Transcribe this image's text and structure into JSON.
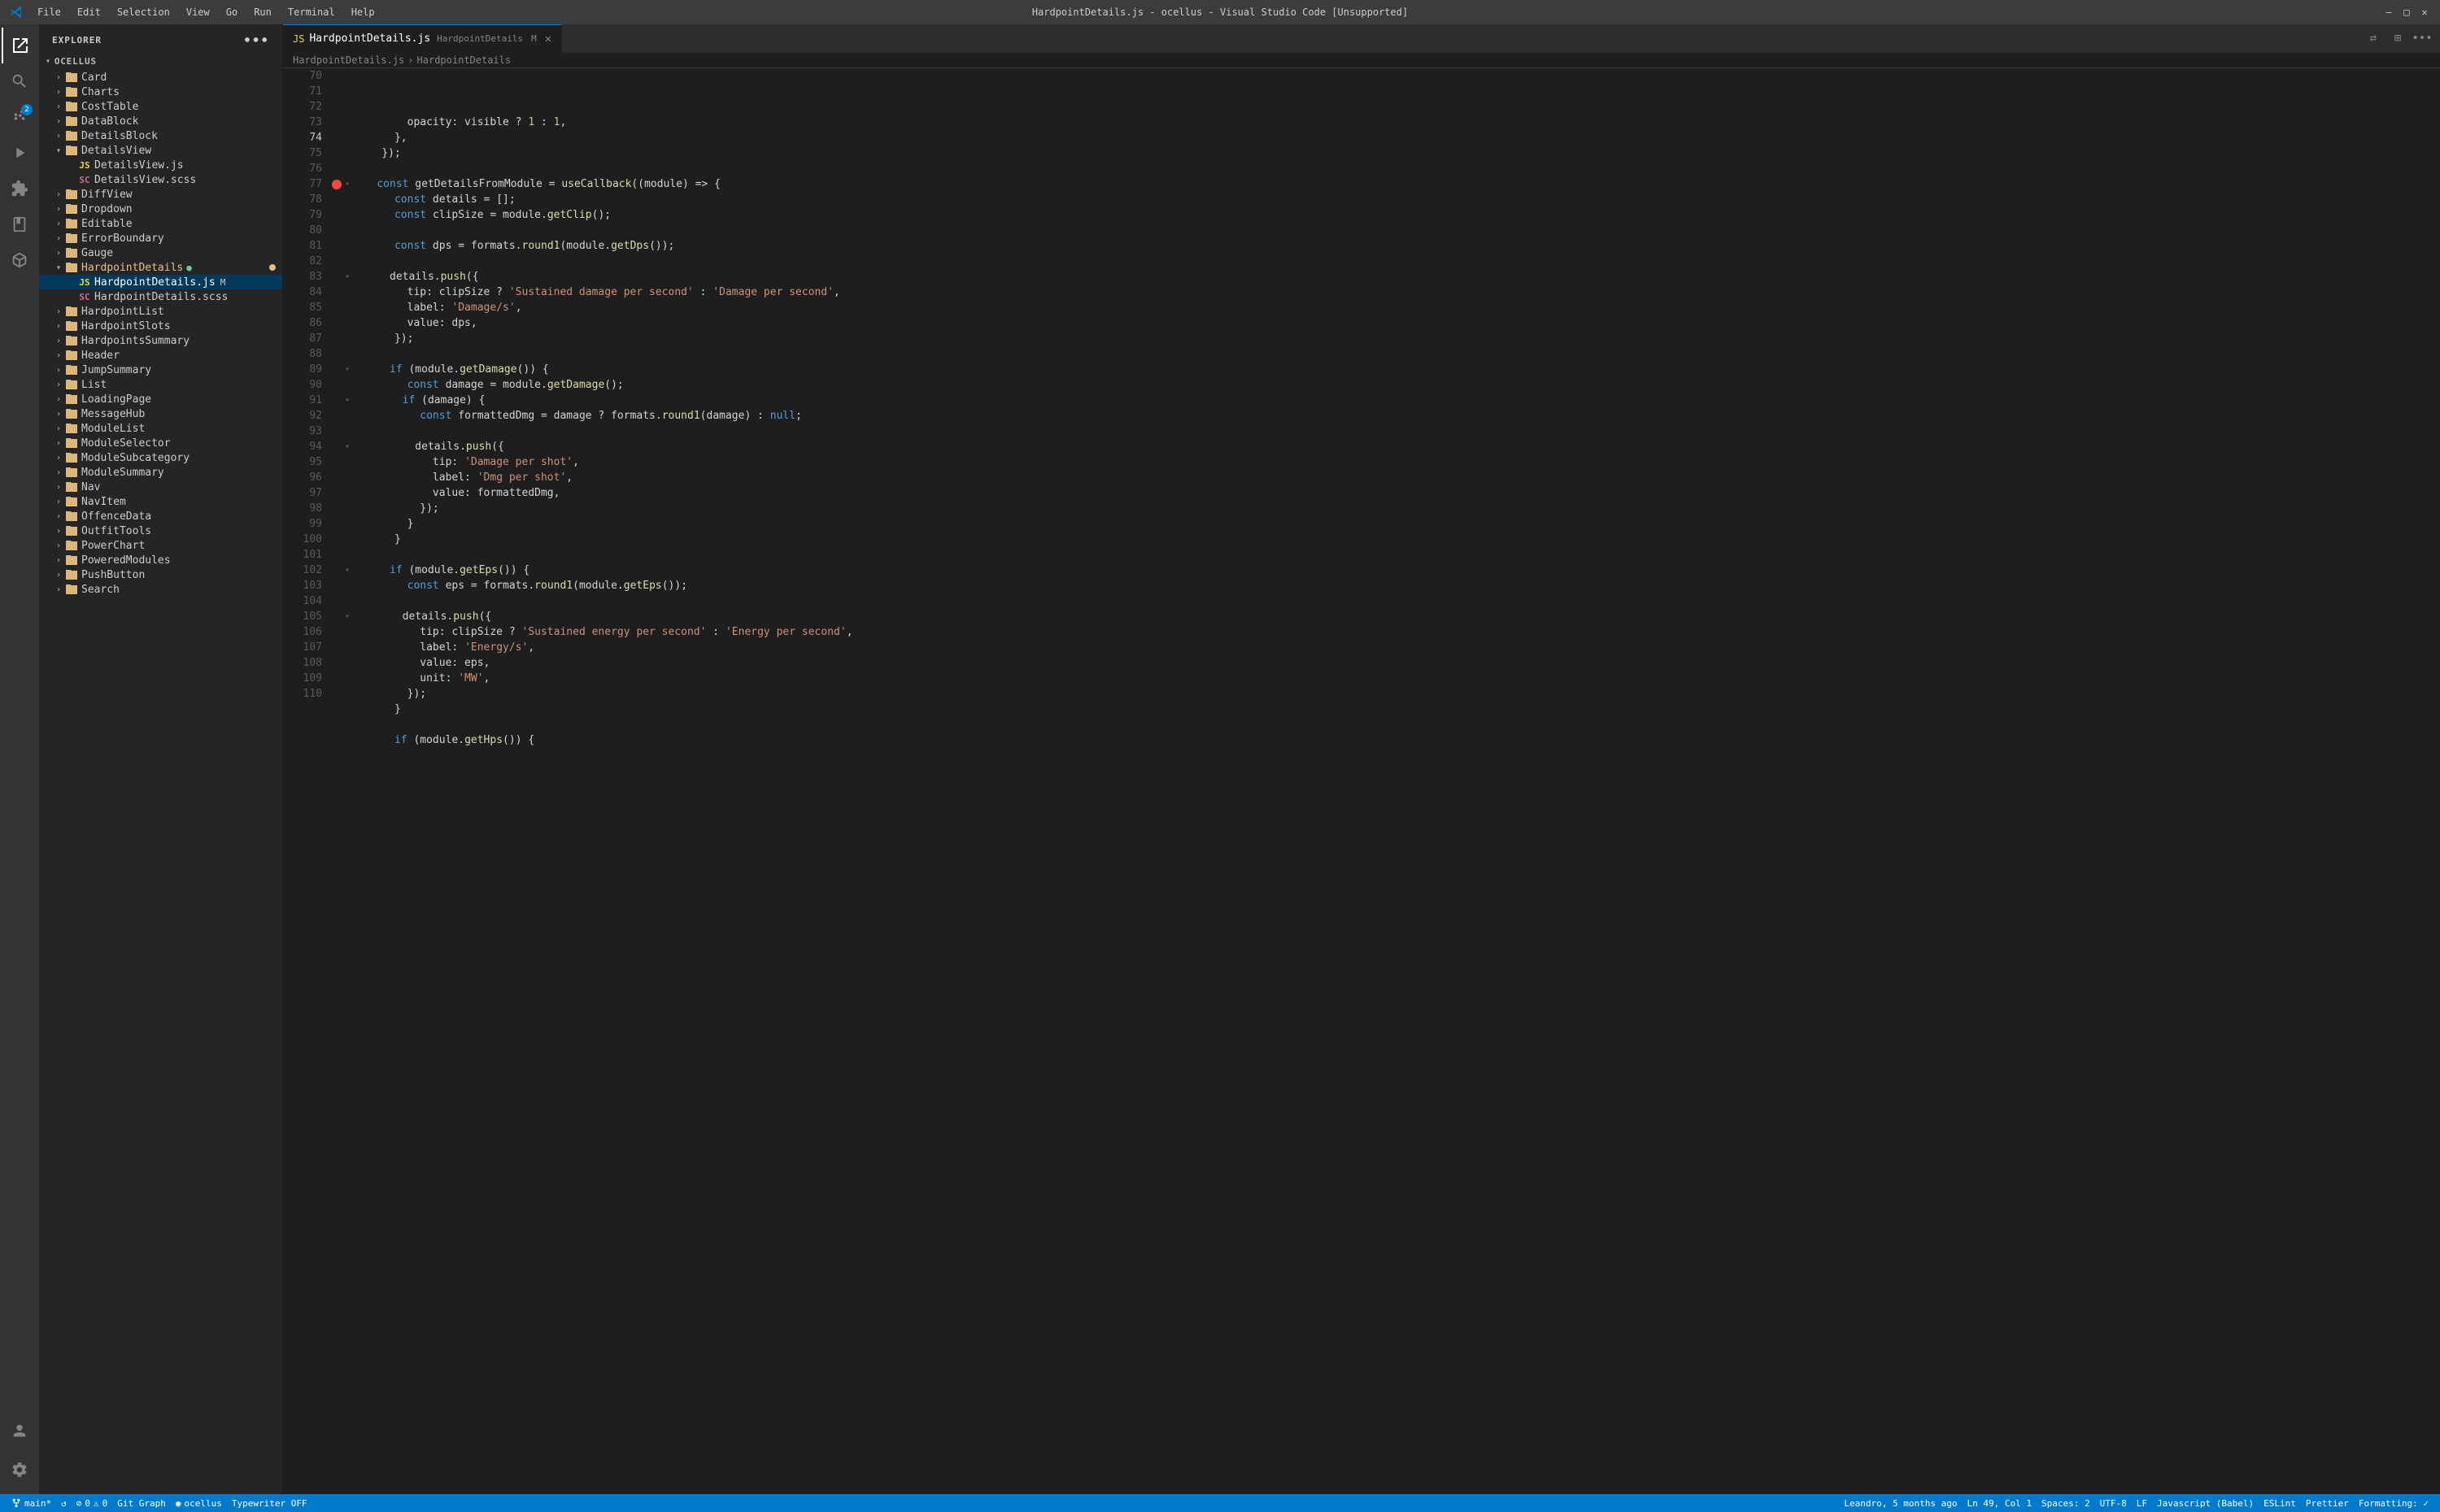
{
  "titleBar": {
    "logo": "VS",
    "menuItems": [
      "File",
      "Edit",
      "Selection",
      "View",
      "Go",
      "Run",
      "Terminal",
      "Help"
    ],
    "title": "HardpointDetails.js - ocellus - Visual Studio Code [Unsupported]",
    "controls": [
      "—",
      "□",
      "✕"
    ]
  },
  "activityBar": {
    "icons": [
      {
        "name": "explorer-icon",
        "symbol": "⎘",
        "active": true,
        "badge": null
      },
      {
        "name": "search-icon",
        "symbol": "🔍",
        "active": false,
        "badge": null
      },
      {
        "name": "source-control-icon",
        "symbol": "⎇",
        "active": false,
        "badge": "2"
      },
      {
        "name": "run-icon",
        "symbol": "▷",
        "active": false,
        "badge": null
      },
      {
        "name": "extensions-icon",
        "symbol": "⊞",
        "active": false,
        "badge": null
      },
      {
        "name": "book-icon",
        "symbol": "📖",
        "active": false,
        "badge": null
      },
      {
        "name": "box-icon",
        "symbol": "📦",
        "active": false,
        "badge": null
      }
    ],
    "bottomIcons": [
      {
        "name": "account-icon",
        "symbol": "👤"
      },
      {
        "name": "settings-icon",
        "symbol": "⚙"
      }
    ]
  },
  "sidebar": {
    "header": "Explorer",
    "moreButton": "•••",
    "section": "OCELLUS",
    "tree": [
      {
        "id": "card",
        "label": "Card",
        "type": "folder",
        "depth": 1,
        "expanded": false
      },
      {
        "id": "charts",
        "label": "Charts",
        "type": "folder",
        "depth": 1,
        "expanded": false
      },
      {
        "id": "costtable",
        "label": "CostTable",
        "type": "folder",
        "depth": 1,
        "expanded": false
      },
      {
        "id": "datablock",
        "label": "DataBlock",
        "type": "folder",
        "depth": 1,
        "expanded": false
      },
      {
        "id": "detailsblock",
        "label": "DetailsBlock",
        "type": "folder",
        "depth": 1,
        "expanded": false
      },
      {
        "id": "detailsview",
        "label": "DetailsView",
        "type": "folder",
        "depth": 1,
        "expanded": true
      },
      {
        "id": "detailsview-js",
        "label": "DetailsView.js",
        "type": "file-js",
        "depth": 2,
        "expanded": false
      },
      {
        "id": "detailsview-scss",
        "label": "DetailsView.scss",
        "type": "file-scss",
        "depth": 2,
        "expanded": false
      },
      {
        "id": "diffview",
        "label": "DiffView",
        "type": "folder",
        "depth": 1,
        "expanded": false
      },
      {
        "id": "dropdown",
        "label": "Dropdown",
        "type": "folder",
        "depth": 1,
        "expanded": false
      },
      {
        "id": "editable",
        "label": "Editable",
        "type": "folder",
        "depth": 1,
        "expanded": false
      },
      {
        "id": "errorboundary",
        "label": "ErrorBoundary",
        "type": "folder",
        "depth": 1,
        "expanded": false
      },
      {
        "id": "gauge",
        "label": "Gauge",
        "type": "folder",
        "depth": 1,
        "expanded": false
      },
      {
        "id": "hardpointdetails",
        "label": "HardpointDetails",
        "type": "folder",
        "depth": 1,
        "expanded": true,
        "modified": true
      },
      {
        "id": "hardpointdetails-js",
        "label": "HardpointDetails.js",
        "type": "file-js",
        "depth": 2,
        "expanded": false,
        "active": true,
        "modified": true
      },
      {
        "id": "hardpointdetails-scss",
        "label": "HardpointDetails.scss",
        "type": "file-scss",
        "depth": 2,
        "expanded": false
      },
      {
        "id": "hardpointlist",
        "label": "HardpointList",
        "type": "folder",
        "depth": 1,
        "expanded": false
      },
      {
        "id": "hardpointslots",
        "label": "HardpointSlots",
        "type": "folder",
        "depth": 1,
        "expanded": false
      },
      {
        "id": "hardpointssummary",
        "label": "HardpointsSummary",
        "type": "folder",
        "depth": 1,
        "expanded": false
      },
      {
        "id": "header",
        "label": "Header",
        "type": "folder",
        "depth": 1,
        "expanded": false
      },
      {
        "id": "jumpsummary",
        "label": "JumpSummary",
        "type": "folder",
        "depth": 1,
        "expanded": false
      },
      {
        "id": "list",
        "label": "List",
        "type": "folder",
        "depth": 1,
        "expanded": false
      },
      {
        "id": "loadingpage",
        "label": "LoadingPage",
        "type": "folder",
        "depth": 1,
        "expanded": false
      },
      {
        "id": "messagehub",
        "label": "MessageHub",
        "type": "folder",
        "depth": 1,
        "expanded": false
      },
      {
        "id": "modulelist",
        "label": "ModuleList",
        "type": "folder",
        "depth": 1,
        "expanded": false
      },
      {
        "id": "moduleselector",
        "label": "ModuleSelector",
        "type": "folder",
        "depth": 1,
        "expanded": false
      },
      {
        "id": "modulesubcategory",
        "label": "ModuleSubcategory",
        "type": "folder",
        "depth": 1,
        "expanded": false
      },
      {
        "id": "modulesummary",
        "label": "ModuleSummary",
        "type": "folder",
        "depth": 1,
        "expanded": false
      },
      {
        "id": "nav",
        "label": "Nav",
        "type": "folder",
        "depth": 1,
        "expanded": false
      },
      {
        "id": "navitem",
        "label": "NavItem",
        "type": "folder",
        "depth": 1,
        "expanded": false
      },
      {
        "id": "offencedata",
        "label": "OffenceData",
        "type": "folder",
        "depth": 1,
        "expanded": false
      },
      {
        "id": "outfittools",
        "label": "OutfitTools",
        "type": "folder",
        "depth": 1,
        "expanded": false
      },
      {
        "id": "powerchart",
        "label": "PowerChart",
        "type": "folder",
        "depth": 1,
        "expanded": false
      },
      {
        "id": "poweredmodules",
        "label": "PoweredModules",
        "type": "folder",
        "depth": 1,
        "expanded": false
      },
      {
        "id": "pushbutton",
        "label": "PushButton",
        "type": "folder",
        "depth": 1,
        "expanded": false
      },
      {
        "id": "search",
        "label": "Search",
        "type": "folder",
        "depth": 1,
        "expanded": false
      }
    ]
  },
  "tabs": [
    {
      "id": "hardpointdetails-tab",
      "label": "HardpointDetails.js",
      "subtitle": "HardpointDetails",
      "badge": "M",
      "active": true,
      "modified": true
    }
  ],
  "tabActions": [
    "⇄",
    "↑",
    "←",
    "→",
    "↑",
    "⊞",
    "•••"
  ],
  "code": {
    "startLine": 70,
    "lines": [
      {
        "n": 70,
        "content": "        opacity: visible ? 1 : 1,",
        "tokens": [
          {
            "t": "        ",
            "c": ""
          },
          {
            "t": "opacity",
            "c": "prop"
          },
          {
            "t": ": visible ? ",
            "c": "punct"
          },
          {
            "t": "1",
            "c": "num"
          },
          {
            "t": " : ",
            "c": "punct"
          },
          {
            "t": "1",
            "c": "num"
          },
          {
            "t": ",",
            "c": "punct"
          }
        ]
      },
      {
        "n": 71,
        "content": "      },",
        "tokens": [
          {
            "t": "      },",
            "c": "punct"
          }
        ]
      },
      {
        "n": 72,
        "content": "    });",
        "tokens": [
          {
            "t": "    });",
            "c": "punct"
          }
        ]
      },
      {
        "n": 73,
        "content": "",
        "tokens": []
      },
      {
        "n": 74,
        "content": "    const getDetailsFromModule = useCallback((module) => {",
        "breakpoint": true,
        "foldable": true
      },
      {
        "n": 75,
        "content": "      const details = [];"
      },
      {
        "n": 76,
        "content": "      const clipSize = module.getClip();"
      },
      {
        "n": 77,
        "content": ""
      },
      {
        "n": 78,
        "content": "      const dps = formats.round1(module.getDps());"
      },
      {
        "n": 79,
        "content": ""
      },
      {
        "n": 80,
        "content": "      details.push({",
        "foldable": true
      },
      {
        "n": 81,
        "content": "        tip: clipSize ? 'Sustained damage per second' : 'Damage per second',"
      },
      {
        "n": 82,
        "content": "        label: 'Damage/s',"
      },
      {
        "n": 83,
        "content": "        value: dps,"
      },
      {
        "n": 84,
        "content": "      });"
      },
      {
        "n": 85,
        "content": ""
      },
      {
        "n": 86,
        "content": "      if (module.getDamage()) {",
        "foldable": true
      },
      {
        "n": 87,
        "content": "        const damage = module.getDamage();"
      },
      {
        "n": 88,
        "content": "        if (damage) {",
        "foldable": true
      },
      {
        "n": 89,
        "content": "          const formattedDmg = damage ? formats.round1(damage) : null;"
      },
      {
        "n": 90,
        "content": ""
      },
      {
        "n": 91,
        "content": "          details.push({",
        "foldable": true
      },
      {
        "n": 92,
        "content": "            tip: 'Damage per shot',"
      },
      {
        "n": 93,
        "content": "            label: 'Dmg per shot',"
      },
      {
        "n": 94,
        "content": "            value: formattedDmg,"
      },
      {
        "n": 95,
        "content": "          });"
      },
      {
        "n": 96,
        "content": "        }"
      },
      {
        "n": 97,
        "content": "      }"
      },
      {
        "n": 98,
        "content": ""
      },
      {
        "n": 99,
        "content": "      if (module.getEps()) {",
        "foldable": true
      },
      {
        "n": 100,
        "content": "        const eps = formats.round1(module.getEps());"
      },
      {
        "n": 101,
        "content": ""
      },
      {
        "n": 102,
        "content": "        details.push({",
        "foldable": true
      },
      {
        "n": 103,
        "content": "          tip: clipSize ? 'Sustained energy per second' : 'Energy per second',"
      },
      {
        "n": 104,
        "content": "          label: 'Energy/s',"
      },
      {
        "n": 105,
        "content": "          value: eps,"
      },
      {
        "n": 106,
        "content": "          unit: 'MW',"
      },
      {
        "n": 107,
        "content": "        });"
      },
      {
        "n": 108,
        "content": "      }"
      },
      {
        "n": 109,
        "content": ""
      },
      {
        "n": 110,
        "content": "      if (module.getHps()) {"
      }
    ]
  },
  "statusBar": {
    "branch": "main*",
    "syncIcon": "↺",
    "errors": "0",
    "warnings": "0",
    "gitGraphLabel": "Git Graph",
    "ocellus": "ocellus",
    "typwriterLabel": "Typewriter OFF",
    "position": "Ln 49, Col 1",
    "spaces": "Spaces: 2",
    "encoding": "UTF-8",
    "lineEnding": "LF",
    "language": "Javascript (Babel)",
    "linterLabel": "ESLint",
    "prettierLabel": "Prettier",
    "formattingLabel": "Formatting: ✓",
    "userLabel": "Leandro, 5 months ago"
  }
}
